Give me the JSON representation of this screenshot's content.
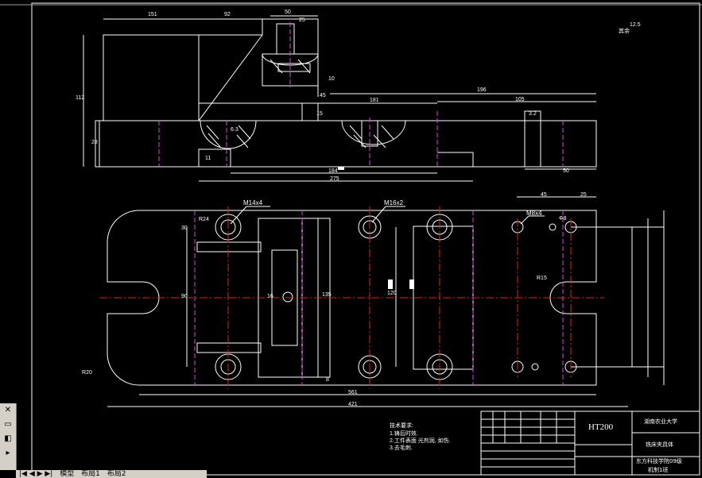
{
  "app": {
    "toolbar": {
      "close_icon": "close-icon",
      "window_icon": "window-icon",
      "panel_icon": "panel-icon"
    },
    "tabs": [
      "模型",
      "布局1",
      "布局2"
    ],
    "tab_nav": "|◀ ◀ ▶ ▶|"
  },
  "drawing": {
    "top_view_dims": {
      "d151": "151",
      "d92": "92",
      "d50": "50",
      "d25": "25",
      "d112": "112",
      "d28": "28",
      "d10": "10",
      "d45": "45",
      "d181": "181",
      "d196": "196",
      "d105": "105",
      "d184": "184",
      "d275": "275",
      "d50b": "50",
      "d11": "11",
      "d15": "15",
      "d6_3": "6.3",
      "d3_2": "3.2",
      "d12_5": "12.5",
      "rest": "其余"
    },
    "plan_view_labels": {
      "m14": "M14x4",
      "m16": "M16x2",
      "m8": "M8x4",
      "d30": "30",
      "d90": "90",
      "d16": "16",
      "d135": "135",
      "d120": "120",
      "d45": "45",
      "d25": "25",
      "d8": "8",
      "d561": "561",
      "d421": "421",
      "r20": "R20",
      "r15": "R15",
      "r24": "R24",
      "d21": "Φ8"
    },
    "notes": {
      "heading": "技术要求:",
      "lines": [
        "1.铸后时效.",
        "2.工件表面 光剂润, 如伤.",
        "3.去毛刺."
      ]
    },
    "title_block": {
      "material": "HT200",
      "university": "湖南农业大学",
      "part_name": "铣床夹具体",
      "school": "东方科技学院09级",
      "class": "机制1班"
    }
  }
}
